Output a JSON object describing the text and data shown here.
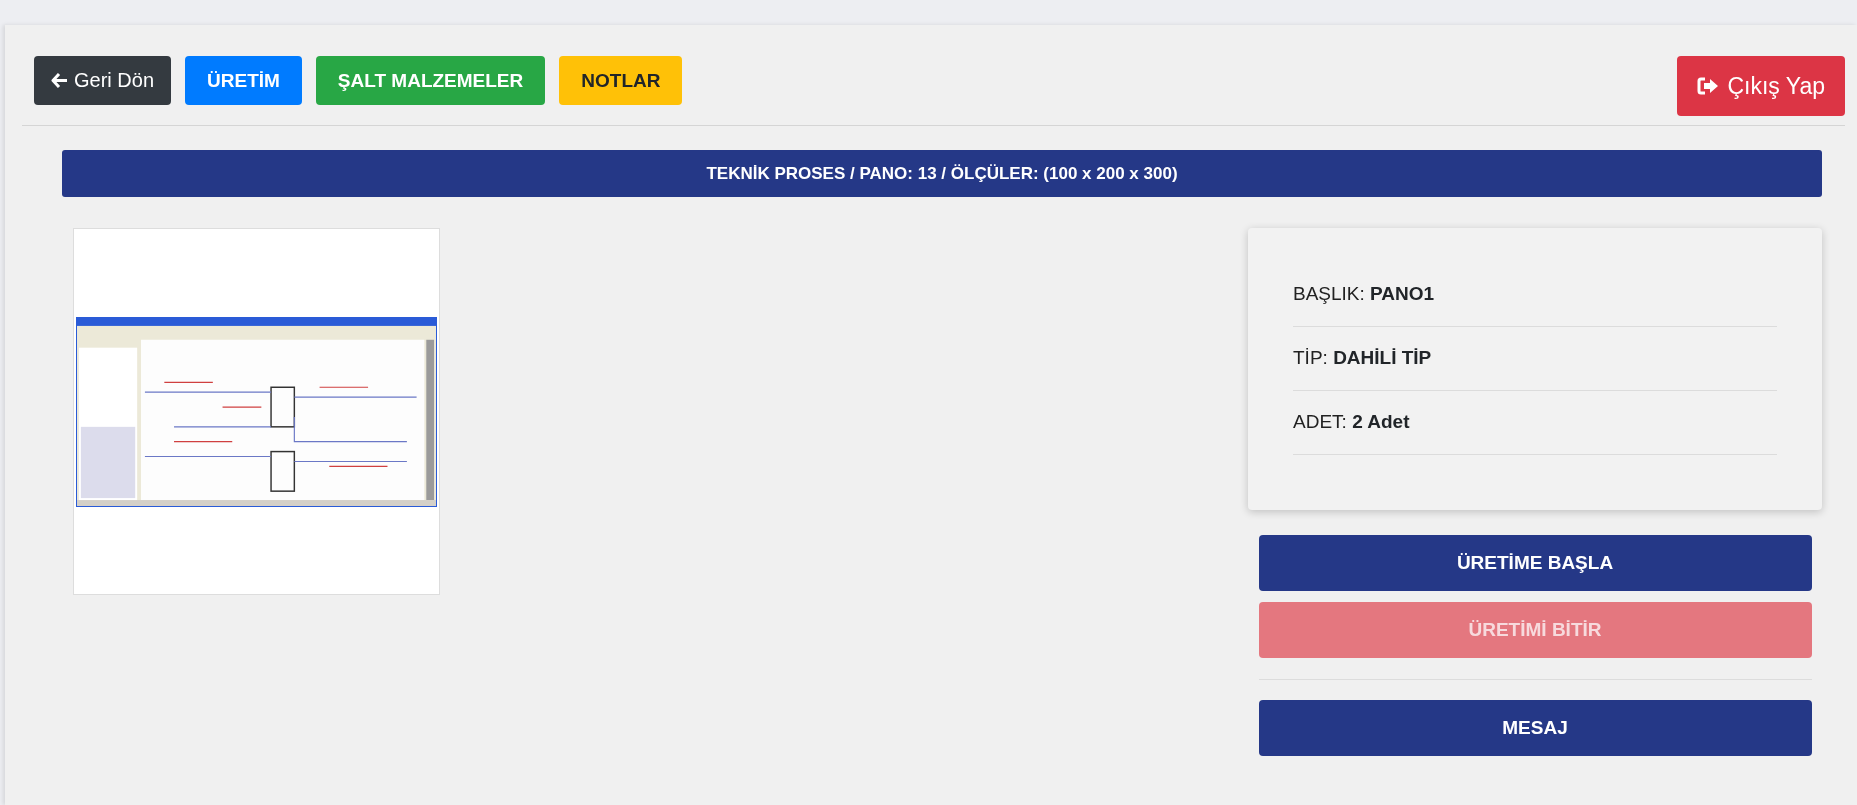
{
  "nav_buttons": [
    {
      "label": "Geri Dön",
      "kind": "back"
    },
    {
      "label": "ÜRETİM",
      "kind": "primary"
    },
    {
      "label": "ŞALT MALZEMELER",
      "kind": "success"
    },
    {
      "label": "NOTLAR",
      "kind": "warning"
    }
  ],
  "logout_button": {
    "label": "Çıkış Yap"
  },
  "title": "TEKNİK PROSES / PANO: 13 / ÖLÇÜLER: (100 x 200 x 300)",
  "info": [
    {
      "label": "BAŞLIK:",
      "value": "PANO1"
    },
    {
      "label": "TİP:",
      "value": "DAHİLİ TİP"
    },
    {
      "label": "ADET:",
      "value": "2 Adet"
    }
  ],
  "actions": [
    {
      "label": "ÜRETİME BAŞLA",
      "disabled": false
    },
    {
      "label": "ÜRETİMİ BİTİR",
      "disabled": true
    }
  ],
  "message_button": {
    "label": "MESAJ"
  }
}
